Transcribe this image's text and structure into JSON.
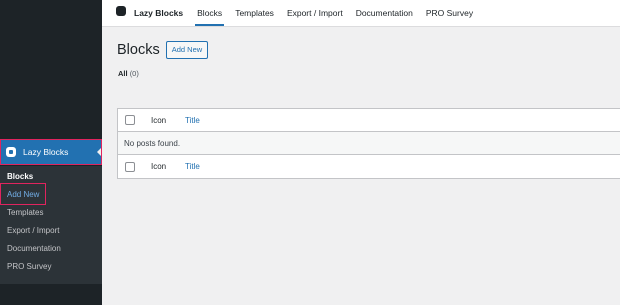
{
  "sidebar": {
    "menu_label": "Lazy Blocks",
    "items": [
      {
        "label": "Blocks"
      },
      {
        "label": "Add New"
      },
      {
        "label": "Templates"
      },
      {
        "label": "Export / Import"
      },
      {
        "label": "Documentation"
      },
      {
        "label": "PRO Survey"
      }
    ]
  },
  "topnav": {
    "brand": "Lazy Blocks",
    "items": [
      {
        "label": "Blocks"
      },
      {
        "label": "Templates"
      },
      {
        "label": "Export / Import"
      },
      {
        "label": "Documentation"
      },
      {
        "label": "PRO Survey"
      }
    ]
  },
  "main": {
    "title": "Blocks",
    "add_new_label": "Add New",
    "views": {
      "all_label": "All",
      "all_count": "(0)"
    },
    "table": {
      "columns": {
        "icon": "Icon",
        "title": "Title"
      },
      "empty_message": "No posts found."
    }
  },
  "colors": {
    "accent": "#2271b1",
    "highlight": "#e0245e",
    "sidebar_bg": "#1d2327"
  }
}
